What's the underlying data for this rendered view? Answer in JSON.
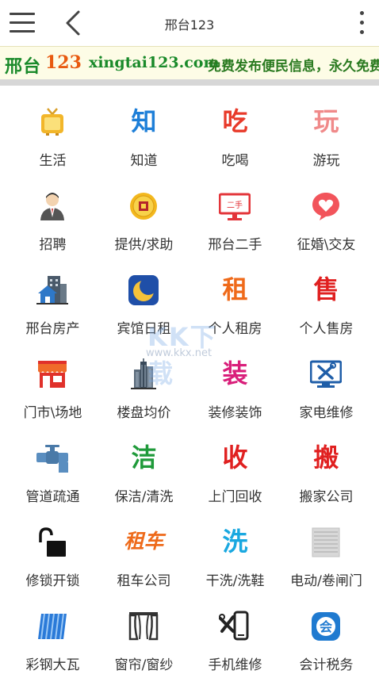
{
  "header": {
    "title": "邢台123"
  },
  "banner": {
    "site_name_1": "邢台",
    "site_name_2": "123",
    "domain": "xingtai123.com",
    "slogan": "免费发布便民信息，永久免费！"
  },
  "watermark": {
    "logo": "KK下载",
    "url": "www.kkx.net"
  },
  "categories": [
    {
      "label": "生活",
      "icon": "tv-icon"
    },
    {
      "label": "知道",
      "icon": "zhi-text-icon",
      "glyph": "知",
      "color": "#1e7fd8"
    },
    {
      "label": "吃喝",
      "icon": "chi-text-icon",
      "glyph": "吃",
      "color": "#e83a2a"
    },
    {
      "label": "游玩",
      "icon": "wan-text-icon",
      "glyph": "玩",
      "color": "#f08a8a"
    },
    {
      "label": "招聘",
      "icon": "person-icon"
    },
    {
      "label": "提供/求助",
      "icon": "coin-icon"
    },
    {
      "label": "邢台二手",
      "icon": "monitor-icon",
      "monitor_text": "二手"
    },
    {
      "label": "征婚\\交友",
      "icon": "heart-chat-icon"
    },
    {
      "label": "邢台房产",
      "icon": "building-house-icon"
    },
    {
      "label": "宾馆日租",
      "icon": "moon-icon"
    },
    {
      "label": "个人租房",
      "icon": "zu-text-icon",
      "glyph": "租",
      "color": "#ef6a1a"
    },
    {
      "label": "个人售房",
      "icon": "shou-text-icon",
      "glyph": "售",
      "color": "#e02020"
    },
    {
      "label": "门市\\场地",
      "icon": "storefront-icon"
    },
    {
      "label": "楼盘均价",
      "icon": "skyscraper-icon"
    },
    {
      "label": "装修装饰",
      "icon": "zhuang-text-icon",
      "glyph": "装",
      "color": "#d91e7a"
    },
    {
      "label": "家电维修",
      "icon": "tools-monitor-icon"
    },
    {
      "label": "管道疏通",
      "icon": "pipe-valve-icon"
    },
    {
      "label": "保洁/清洗",
      "icon": "jie-text-icon",
      "glyph": "洁",
      "color": "#1f9a3a"
    },
    {
      "label": "上门回收",
      "icon": "shou2-text-icon",
      "glyph": "收",
      "color": "#e02020"
    },
    {
      "label": "搬家公司",
      "icon": "ban-text-icon",
      "glyph": "搬",
      "color": "#e02020"
    },
    {
      "label": "修锁开锁",
      "icon": "padlock-icon"
    },
    {
      "label": "租车公司",
      "icon": "zuche-text-icon",
      "glyph": "租车",
      "color": "#ee6a1a"
    },
    {
      "label": "干洗/洗鞋",
      "icon": "xi-text-icon",
      "glyph": "洗",
      "color": "#1aa8e0"
    },
    {
      "label": "电动/卷闸门",
      "icon": "shutter-door-icon"
    },
    {
      "label": "彩钢大瓦",
      "icon": "steel-roof-icon"
    },
    {
      "label": "窗帘/窗纱",
      "icon": "curtain-icon"
    },
    {
      "label": "手机维修",
      "icon": "phone-tools-icon"
    },
    {
      "label": "会计税务",
      "icon": "accounting-icon",
      "badge_text": "会"
    }
  ]
}
